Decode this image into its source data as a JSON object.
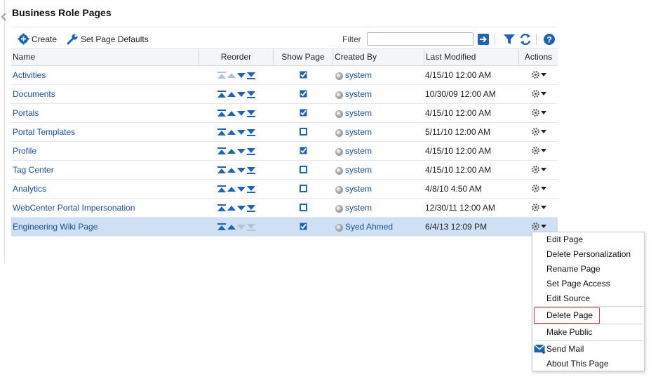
{
  "page": {
    "title": "Business Role Pages"
  },
  "toolbar": {
    "create_label": "Create",
    "set_defaults_label": "Set Page Defaults",
    "filter_label": "Filter",
    "filter_value": ""
  },
  "columns": {
    "name": "Name",
    "reorder": "Reorder",
    "show_page": "Show Page",
    "created_by": "Created By",
    "last_modified": "Last Modified",
    "actions": "Actions"
  },
  "rows": [
    {
      "name": "Activities",
      "show": true,
      "created_by": "system",
      "last_modified": "4/15/10 12:00 AM"
    },
    {
      "name": "Documents",
      "show": true,
      "created_by": "system",
      "last_modified": "10/30/09 12:00 AM"
    },
    {
      "name": "Portals",
      "show": true,
      "created_by": "system",
      "last_modified": "4/15/10 12:00 AM"
    },
    {
      "name": "Portal Templates",
      "show": false,
      "created_by": "system",
      "last_modified": "5/11/10 12:00 AM"
    },
    {
      "name": "Profile",
      "show": true,
      "created_by": "system",
      "last_modified": "4/15/10 12:00 AM"
    },
    {
      "name": "Tag Center",
      "show": false,
      "created_by": "system",
      "last_modified": "4/15/10 12:00 AM"
    },
    {
      "name": "Analytics",
      "show": false,
      "created_by": "system",
      "last_modified": "4/8/10 4:50 AM"
    },
    {
      "name": "WebCenter Portal Impersonation",
      "show": false,
      "created_by": "system",
      "last_modified": "12/30/11 12:00 AM"
    },
    {
      "name": "Engineering Wiki Page",
      "show": true,
      "created_by": "Syed Ahmed",
      "last_modified": "6/4/13 12:09 PM",
      "selected": true
    }
  ],
  "menu": {
    "items": [
      "Edit Page",
      "Delete Personalization",
      "Rename Page",
      "Set Page Access",
      "Edit Source",
      "Delete Page",
      "Make Public",
      "Send Mail",
      "About This Page"
    ]
  },
  "colors": {
    "link": "#1a4fa0",
    "icon_blue": "#1d63b8",
    "selected_row": "#cfe0f5",
    "highlight_border": "#c23a3a"
  }
}
